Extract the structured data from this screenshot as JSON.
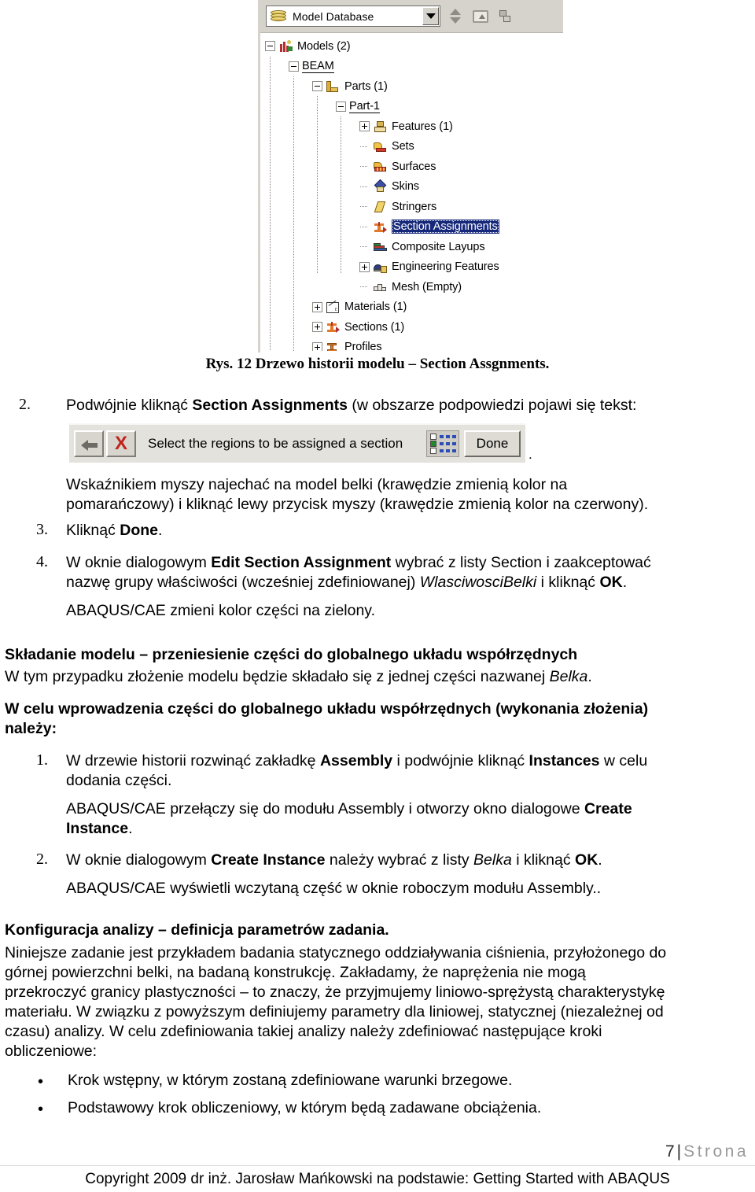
{
  "figure": {
    "toolbar": {
      "database_label": "Model Database",
      "dropdown_icon": "chevron-down-icon",
      "spinner_icon": "up-down-spinner-icon",
      "folder_up_icon": "folder-up-icon",
      "layers_icon": "layers-icon"
    },
    "tree": [
      {
        "label": "Models (2)",
        "depth": 0,
        "toggle": "minus",
        "icon": "models-icon",
        "selected": false,
        "underline": false
      },
      {
        "label": "BEAM",
        "depth": 1,
        "toggle": "minus",
        "icon": "none",
        "selected": false,
        "underline": true
      },
      {
        "label": "Parts (1)",
        "depth": 2,
        "toggle": "minus",
        "icon": "part-icon",
        "selected": false,
        "underline": false
      },
      {
        "label": "Part-1",
        "depth": 3,
        "toggle": "minus",
        "icon": "none",
        "selected": false,
        "underline": true
      },
      {
        "label": "Features (1)",
        "depth": 4,
        "toggle": "plus",
        "icon": "feature-icon",
        "selected": false,
        "underline": false
      },
      {
        "label": "Sets",
        "depth": 4,
        "toggle": "dots",
        "icon": "sets-icon",
        "selected": false,
        "underline": false
      },
      {
        "label": "Surfaces",
        "depth": 4,
        "toggle": "dots",
        "icon": "surfaces-icon",
        "selected": false,
        "underline": false
      },
      {
        "label": "Skins",
        "depth": 4,
        "toggle": "dots",
        "icon": "skins-icon",
        "selected": false,
        "underline": false
      },
      {
        "label": "Stringers",
        "depth": 4,
        "toggle": "dots",
        "icon": "stringers-icon",
        "selected": false,
        "underline": false
      },
      {
        "label": "Section Assignments",
        "depth": 4,
        "toggle": "dots",
        "icon": "section-assignments-icon",
        "selected": true,
        "underline": false
      },
      {
        "label": "Composite Layups",
        "depth": 4,
        "toggle": "dots",
        "icon": "composite-layups-icon",
        "selected": false,
        "underline": false
      },
      {
        "label": "Engineering Features",
        "depth": 4,
        "toggle": "plus",
        "icon": "engineering-features-icon",
        "selected": false,
        "underline": false
      },
      {
        "label": "Mesh (Empty)",
        "depth": 4,
        "toggle": "dots",
        "icon": "mesh-icon",
        "selected": false,
        "underline": false
      },
      {
        "label": "Materials (1)",
        "depth": 2,
        "toggle": "plus",
        "icon": "materials-icon",
        "selected": false,
        "underline": false
      },
      {
        "label": "Sections (1)",
        "depth": 2,
        "toggle": "plus",
        "icon": "sections-icon",
        "selected": false,
        "underline": false
      },
      {
        "label": "Profiles",
        "depth": 2,
        "toggle": "plus",
        "icon": "profiles-icon",
        "selected": false,
        "underline": false
      }
    ],
    "caption": "Rys. 12 Drzewo historii modelu – Section Assgnments."
  },
  "prompt_bar": {
    "back_icon": "back-arrow-icon",
    "cancel_icon": "cancel-x-icon",
    "message": "Select the regions to be assigned a section",
    "selection_icon": "selection-grid-icon",
    "done_label": "Done",
    "trailing_period": "."
  },
  "steps_section": {
    "item2_number": "2.",
    "item2_text_a": "Podwójnie kliknąć ",
    "item2_bold": "Section Assignments",
    "item2_text_b": " (w obszarze podpowiedzi pojawi się tekst:",
    "para_mouse_line1": "Wskaźnikiem myszy najechać na model belki (krawędzie zmienią kolor na",
    "para_mouse_line2": "pomarańczowy) i kliknąć lewy przycisk myszy (krawędzie zmienią kolor na czerwony).",
    "item3_number": "3.",
    "item3_text_a": "Kliknąć ",
    "item3_bold": "Done",
    "item3_text_b": ".",
    "item4_number": "4.",
    "item4_text_a": "W oknie dialogowym ",
    "item4_bold_a": "Edit Section Assignment",
    "item4_text_b": " wybrać z listy Section i zaakceptować",
    "item4_text_c": "nazwę grupy właściwości (wcześniej zdefiniowanej) ",
    "item4_italic": "WlasciwosciBelki",
    "item4_text_d": " i kliknąć ",
    "item4_bold_b": "OK",
    "item4_text_e": ".",
    "item4_note": "ABAQUS/CAE zmieni kolor części na zielony."
  },
  "assembly_section": {
    "heading": "Składanie modelu – przeniesienie części do globalnego układu współrzędnych",
    "intro_a": "W tym przypadku złożenie modelu będzie składało się z jednej części nazwanej ",
    "intro_italic": "Belka",
    "intro_b": ".",
    "bold_intro_line1": "W celu wprowadzenia części do globalnego układu współrzędnych (wykonania złożenia)",
    "bold_intro_line2": "należy:",
    "item1_number": "1.",
    "item1_text_a": "W drzewie historii rozwinąć zakładkę ",
    "item1_bold_a": "Assembly",
    "item1_text_b": " i podwójnie kliknąć ",
    "item1_bold_b": "Instances",
    "item1_text_c": " w celu",
    "item1_text_d": "dodania części.",
    "item1_note_a": "ABAQUS/CAE przełączy się do modułu Assembly i otworzy okno dialogowe ",
    "item1_note_bold": "Create",
    "item1_note_bold2": "Instance",
    "item1_note_b": ".",
    "item2_number": "2.",
    "item2_text_a": "W oknie dialogowym ",
    "item2_bold_a": "Create Instance",
    "item2_text_b": " należy wybrać z listy ",
    "item2_italic": "Belka",
    "item2_text_c": " i kliknąć ",
    "item2_bold_b": "OK",
    "item2_text_d": ".",
    "item2_note": "ABAQUS/CAE wyświetli wczytaną część w oknie roboczym modułu Assembly.."
  },
  "config_section": {
    "heading": "Konfiguracja analizy – definicja parametrów zadania.",
    "body_line1": "Niniejsze zadanie jest przykładem badania statycznego oddziaływania ciśnienia, przyłożonego do",
    "body_line2": "górnej powierzchni belki, na badaną konstrukcję. Zakładamy, że naprężenia nie mogą",
    "body_line3": "przekroczyć granicy plastyczności – to znaczy, że przyjmujemy liniowo-sprężystą charakterystykę",
    "body_line4": "materiału. W związku z powyższym definiujemy parametry dla liniowej, statycznej (niezależnej od",
    "body_line5": "czasu) analizy. W celu zdefiniowania takiej analizy należy zdefiniować następujące kroki",
    "body_line6": "obliczeniowe:",
    "bullet1": "Krok wstępny, w którym zostaną zdefiniowane warunki brzegowe.",
    "bullet2": "Podstawowy krok obliczeniowy, w którym będą zadawane obciążenia.",
    "bullet_glyph": "•"
  },
  "footer": {
    "page_number": "7",
    "separator": "|",
    "page_word": "Strona",
    "copyright": "Copyright 2009 dr inż. Jarosław Mańkowski na podstawie: Getting Started with ABAQUS"
  }
}
